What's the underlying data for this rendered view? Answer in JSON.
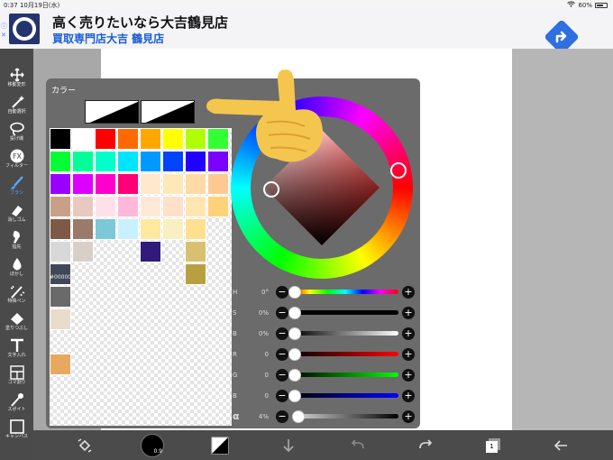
{
  "status": {
    "time": "0:37",
    "date": "10月19日(水)",
    "battery": "60%"
  },
  "ad": {
    "title": "高く売りたいなら大吉鶴見店",
    "subtitle": "買取専門店大吉 鶴見店",
    "info_icon": "info-icon",
    "close_icon": "close-icon",
    "accent": "#2f6fe0"
  },
  "tools": [
    {
      "label": "移動変形",
      "icon": "move-icon"
    },
    {
      "label": "自動選択",
      "icon": "magic-wand-icon"
    },
    {
      "label": "投げ縄",
      "icon": "lasso-icon"
    },
    {
      "label": "フィルター",
      "icon": "fx-icon"
    },
    {
      "label": "ブラシ",
      "icon": "brush-icon",
      "active": true
    },
    {
      "label": "消しゴム",
      "icon": "eraser-icon"
    },
    {
      "label": "指先",
      "icon": "finger-icon"
    },
    {
      "label": "ぼかし",
      "icon": "blur-icon"
    },
    {
      "label": "特殊ペン",
      "icon": "special-pen-icon"
    },
    {
      "label": "塗りつぶし",
      "icon": "fill-icon"
    },
    {
      "label": "文字入れ",
      "icon": "text-icon"
    },
    {
      "label": "コマ割り",
      "icon": "frame-divide-icon"
    },
    {
      "label": "スポイト",
      "icon": "eyedropper-icon"
    },
    {
      "label": "キャンバス",
      "icon": "canvas-icon"
    }
  ],
  "color_panel": {
    "title": "カラー",
    "hex": "#000000",
    "palette": [
      [
        "#000000",
        "#ffffff",
        "#ff0000",
        "#ff6a00",
        "#ffa800",
        "#ffff00",
        "#b0ff00",
        "#33ff33"
      ],
      [
        "#00ff33",
        "#00ff99",
        "#00ffcc",
        "#00e5ff",
        "#0099ff",
        "#0044ff",
        "#2200ff",
        "#7a00ff"
      ],
      [
        "#9900ff",
        "#dd00ff",
        "#ff00cc",
        "#ff0077",
        "#ffe8cc",
        "#ffe8b8",
        "#ffd9a6",
        "#ffc890"
      ],
      [
        "#c8a088",
        "#e9c8c0",
        "#ffe0e8",
        "#ffb8d8",
        "#ffe8d8",
        "#ffe0c8",
        "#ffe6b0",
        "#ffd27a"
      ],
      [
        "#7d5a46",
        "#9a7a6a",
        "#7ac8d8",
        "#c8f0ff",
        "#ffe8a0",
        "#f8f0c0",
        "#ffe090",
        "",
        ""
      ],
      [
        "#d8d8d8",
        "#d8d0c8",
        "",
        "",
        "#301a7a",
        "",
        "#d8c070",
        ""
      ],
      [
        "#404858",
        "",
        "",
        "",
        "",
        "",
        "#b8a040",
        ""
      ],
      [
        "#6a6a6a",
        "",
        "",
        "",
        "",
        "",
        "",
        ""
      ],
      [
        "#e8dccc",
        "",
        "",
        "",
        "",
        "",
        "",
        ""
      ],
      [
        "",
        "",
        "",
        "",
        "",
        "",
        "",
        ""
      ],
      [
        "#e8a860",
        "",
        "",
        "",
        "",
        "",
        "",
        ""
      ]
    ],
    "sliders": [
      {
        "label": "H",
        "value": "0°",
        "position": 0.0
      },
      {
        "label": "S",
        "value": "0%",
        "position": 0.0
      },
      {
        "label": "B",
        "value": "0%",
        "position": 0.0
      },
      {
        "label": "R",
        "value": "0",
        "position": 0.0
      },
      {
        "label": "G",
        "value": "0",
        "position": 0.0
      },
      {
        "label": "B",
        "value": "0",
        "position": 0.0
      },
      {
        "label": "α",
        "value": "4%",
        "position": 0.04
      }
    ]
  },
  "bottom": {
    "brush_size_label": "0.9",
    "layer_count": "1"
  }
}
